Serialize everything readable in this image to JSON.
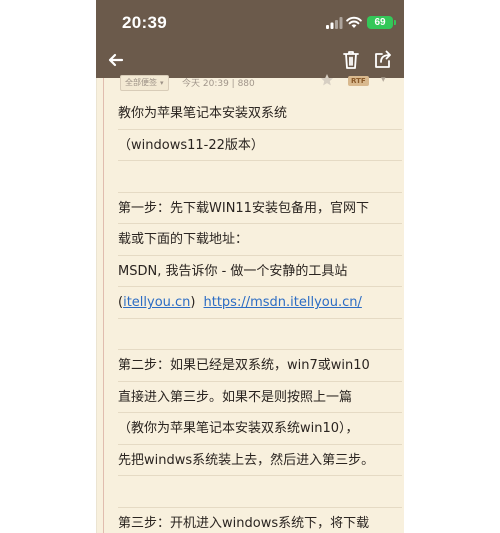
{
  "status_bar": {
    "time": "20:39",
    "battery": "69",
    "icons": [
      "cellular-signal-icon",
      "wifi-icon",
      "battery-icon"
    ]
  },
  "toolbar": {
    "icons": [
      "back-arrow-icon",
      "trash-icon",
      "share-icon"
    ]
  },
  "note_meta": {
    "notebook": "全部便签",
    "date": "今天 20:39",
    "chars": "880",
    "format_badge": "RTF",
    "icons": [
      "star-icon",
      "chevron-down-icon"
    ]
  },
  "note": {
    "lines": [
      {
        "text": "教你为苹果笔记本安装双系统"
      },
      {
        "text": "（windows11-22版本）"
      },
      {
        "text": ""
      },
      {
        "text": "第一步：先下载WIN11安装包备用，官网下"
      },
      {
        "text": "载或下面的下载地址："
      },
      {
        "text": "MSDN, 我告诉你 - 做一个安静的工具站"
      },
      {
        "link1": "itellyou.cn",
        "before": "(",
        "after": ")",
        "link2": "https://msdn.itellyou.cn/"
      },
      {
        "text": ""
      },
      {
        "text": "第二步：如果已经是双系统，win7或win10"
      },
      {
        "text": "直接进入第三步。如果不是则按照上一篇"
      },
      {
        "text": "（教你为苹果笔记本安装双系统win10），"
      },
      {
        "text": "先把windws系统装上去，然后进入第三步。"
      },
      {
        "text": ""
      },
      {
        "text": "第三步：开机进入windows系统下，将下载"
      }
    ]
  },
  "colors": {
    "header_bg": "#6b5a4b",
    "paper_bg": "#f8f0dd",
    "link": "#2b6cc4",
    "battery": "#34c759"
  }
}
